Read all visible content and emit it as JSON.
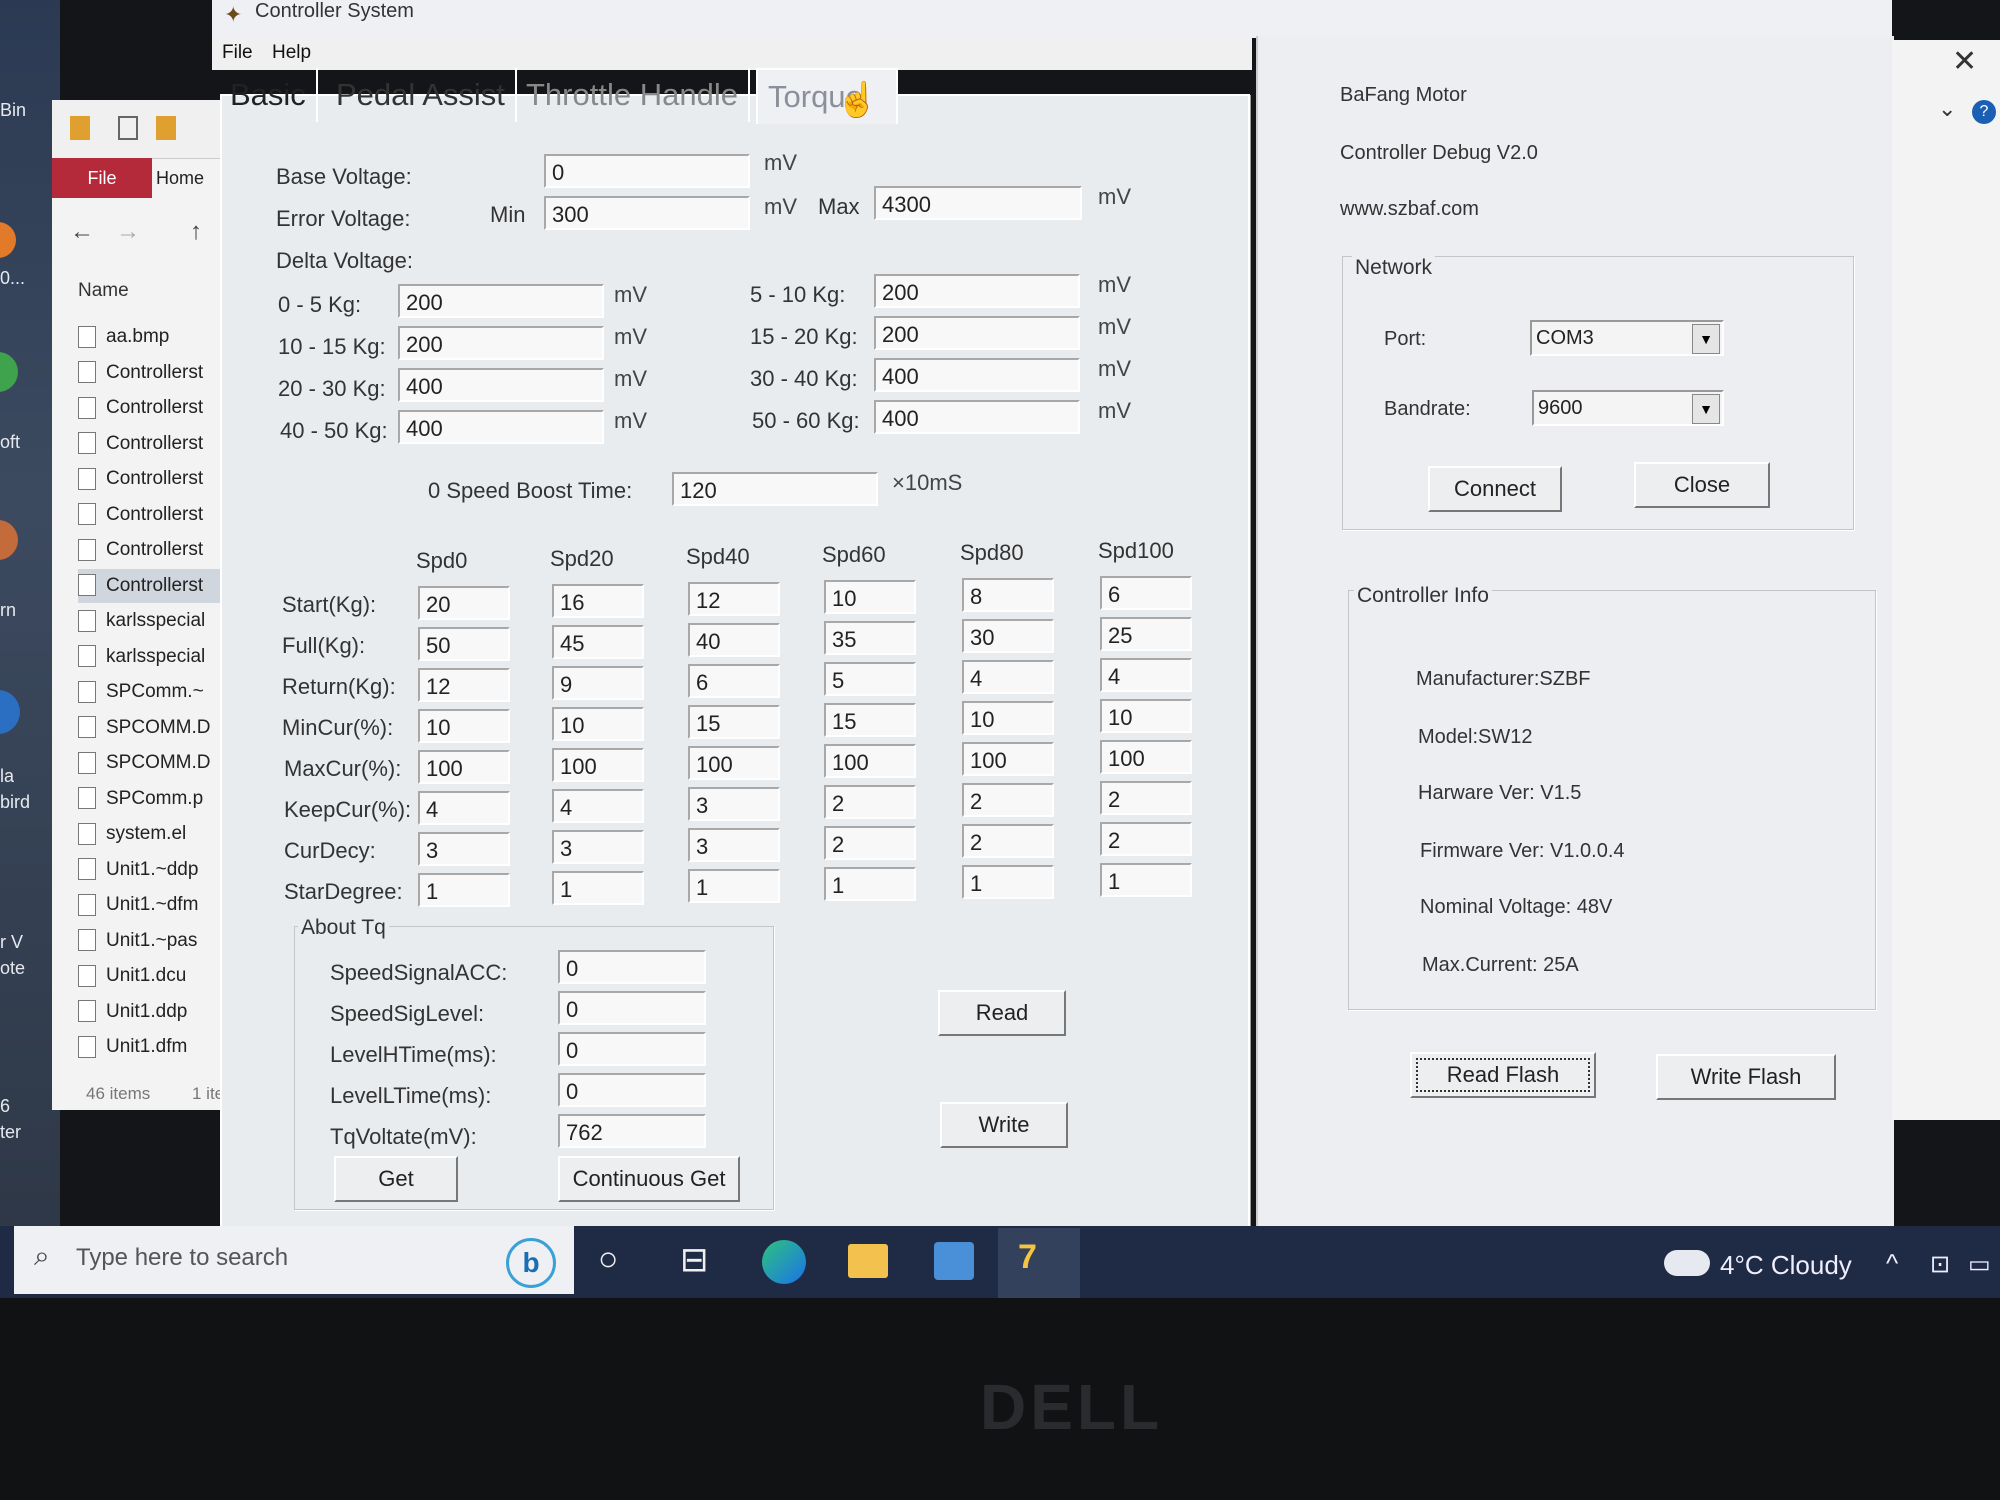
{
  "app": {
    "title": "Controller System"
  },
  "menu": {
    "file": "File",
    "help": "Help"
  },
  "tabs": {
    "basic": "Basic",
    "pedal": "Pedal Assist",
    "throttle": "Throttle Handle",
    "torque": "Torque"
  },
  "torque": {
    "base_voltage": {
      "label": "Base Voltage:",
      "value": "0",
      "unit": "mV"
    },
    "error_voltage": {
      "label": "Error Voltage:",
      "min_label": "Min",
      "min_value": "300",
      "min_unit": "mV",
      "max_label": "Max",
      "max_value": "4300",
      "max_unit": "mV"
    },
    "delta_voltage": {
      "label": "Delta Voltage:",
      "rows": [
        {
          "label": "0 - 5 Kg:",
          "value": "200",
          "unit": "mV"
        },
        {
          "label": "10 - 15 Kg:",
          "value": "200",
          "unit": "mV"
        },
        {
          "label": "20 - 30 Kg:",
          "value": "400",
          "unit": "mV"
        },
        {
          "label": "40 - 50 Kg:",
          "value": "400",
          "unit": "mV"
        },
        {
          "label": "5 - 10 Kg:",
          "value": "200",
          "unit": "mV"
        },
        {
          "label": "15 - 20 Kg:",
          "value": "200",
          "unit": "mV"
        },
        {
          "label": "30 - 40 Kg:",
          "value": "400",
          "unit": "mV"
        },
        {
          "label": "50 - 60 Kg:",
          "value": "400",
          "unit": "mV"
        }
      ]
    },
    "boost": {
      "label": "0 Speed Boost Time:",
      "value": "120",
      "unit": "×10mS"
    },
    "speed_table": {
      "columns": [
        "Spd0",
        "Spd20",
        "Spd40",
        "Spd60",
        "Spd80",
        "Spd100"
      ],
      "rows": [
        {
          "label": "Start(Kg):",
          "values": [
            "20",
            "16",
            "12",
            "10",
            "8",
            "6"
          ]
        },
        {
          "label": "Full(Kg):",
          "values": [
            "50",
            "45",
            "40",
            "35",
            "30",
            "25"
          ]
        },
        {
          "label": "Return(Kg):",
          "values": [
            "12",
            "9",
            "6",
            "5",
            "4",
            "4"
          ]
        },
        {
          "label": "MinCur(%):",
          "values": [
            "10",
            "10",
            "15",
            "15",
            "10",
            "10"
          ]
        },
        {
          "label": "MaxCur(%):",
          "values": [
            "100",
            "100",
            "100",
            "100",
            "100",
            "100"
          ]
        },
        {
          "label": "KeepCur(%):",
          "values": [
            "4",
            "4",
            "3",
            "2",
            "2",
            "2"
          ]
        },
        {
          "label": "CurDecy:",
          "values": [
            "3",
            "3",
            "3",
            "2",
            "2",
            "2"
          ]
        },
        {
          "label": "StarDegree:",
          "values": [
            "1",
            "1",
            "1",
            "1",
            "1",
            "1"
          ]
        }
      ]
    },
    "about": {
      "title": "About Tq",
      "rows": [
        {
          "label": "SpeedSignalACC:",
          "value": "0"
        },
        {
          "label": "SpeedSigLevel:",
          "value": "0"
        },
        {
          "label": "LevelHTime(ms):",
          "value": "0"
        },
        {
          "label": "LevelLTime(ms):",
          "value": "0"
        },
        {
          "label": "TqVoltate(mV):",
          "value": "762"
        }
      ],
      "get": "Get",
      "continuous_get": "Continuous Get"
    },
    "read": "Read",
    "write": "Write"
  },
  "info": {
    "line1": "BaFang Motor",
    "line2": "Controller Debug V2.0",
    "line3": "www.szbaf.com",
    "network": {
      "title": "Network",
      "port_label": "Port:",
      "port_value": "COM3",
      "baud_label": "Bandrate:",
      "baud_value": "9600",
      "connect": "Connect",
      "close": "Close"
    },
    "controller": {
      "title": "Controller Info",
      "manufacturer": "Manufacturer:SZBF",
      "model": "Model:SW12",
      "hardware": "Harware Ver: V1.5",
      "firmware": "Firmware Ver: V1.0.0.4",
      "voltage": "Nominal Voltage: 48V",
      "current": "Max.Current: 25A"
    },
    "read_flash": "Read Flash",
    "write_flash": "Write Flash"
  },
  "explorer": {
    "file_tab": "File",
    "home_tab": "Home",
    "name_header": "Name",
    "items": [
      "aa.bmp",
      "Controllerst",
      "Controllerst",
      "Controllerst",
      "Controllerst",
      "Controllerst",
      "Controllerst",
      "Controllerst",
      "karlsspecial",
      "karlsspecial",
      "SPComm.~",
      "SPCOMM.D",
      "SPCOMM.D",
      "SPComm.p",
      "system.el",
      "Unit1.~ddp",
      "Unit1.~dfm",
      "Unit1.~pas",
      "Unit1.dcu",
      "Unit1.ddp",
      "Unit1.dfm"
    ],
    "status_count": "46 items",
    "status_sel": "1 ite"
  },
  "desktop": {
    "labels": [
      "Bin",
      "0...",
      "oft",
      "rn",
      "la",
      "bird",
      "r V",
      "ote",
      "6",
      "ter"
    ]
  },
  "taskbar": {
    "search_placeholder": "Type here to search",
    "weather": "4°C  Cloudy"
  },
  "bezel": {
    "brand": "DELL"
  }
}
